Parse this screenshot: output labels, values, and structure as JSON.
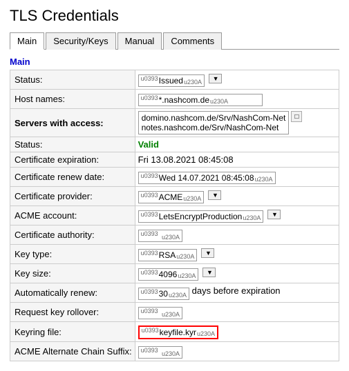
{
  "title": "TLS Credentials",
  "tabs": [
    {
      "label": "Main",
      "active": true
    },
    {
      "label": "Security/Keys",
      "active": false
    },
    {
      "label": "Manual",
      "active": false
    },
    {
      "label": "Comments",
      "active": false
    }
  ],
  "section": "Main",
  "fields": [
    {
      "label": "Status:",
      "bold": false,
      "type": "field-dropdown",
      "value": "Issued",
      "hasDropdown": true
    },
    {
      "label": "Host names:",
      "bold": false,
      "type": "field",
      "value": "*.nashcom.de"
    },
    {
      "label": "Servers with access:",
      "bold": true,
      "type": "servers",
      "values": [
        "domino.nashcom.de/Srv/NashCom-Net",
        "notes.nashcom.de/Srv/NashCom-Net"
      ]
    },
    {
      "label": "Status:",
      "bold": false,
      "type": "status",
      "value": "Valid"
    },
    {
      "label": "Certificate expiration:",
      "bold": false,
      "type": "text",
      "value": "Fri 13.08.2021 08:45:08"
    },
    {
      "label": "Certificate renew date:",
      "bold": false,
      "type": "field",
      "value": "Wed 14.07.2021 08:45:08"
    },
    {
      "label": "Certificate provider:",
      "bold": false,
      "type": "field-dropdown",
      "value": "ACME",
      "hasDropdown": true
    },
    {
      "label": "ACME account:",
      "bold": false,
      "type": "field-dropdown",
      "value": "LetsEncryptProduction",
      "hasDropdown": true
    },
    {
      "label": "Certificate authority:",
      "bold": false,
      "type": "field",
      "value": ""
    },
    {
      "label": "Key type:",
      "bold": false,
      "type": "field-dropdown",
      "value": "RSA",
      "hasDropdown": true
    },
    {
      "label": "Key size:",
      "bold": false,
      "type": "field-dropdown",
      "value": "4096",
      "hasDropdown": true
    },
    {
      "label": "Automatically renew:",
      "bold": false,
      "type": "text-mixed",
      "value": "30",
      "suffix": " days before expiration"
    },
    {
      "label": "Request key rollover:",
      "bold": false,
      "type": "field",
      "value": ""
    },
    {
      "label": "Keyring file:",
      "bold": false,
      "type": "field-highlight",
      "value": "keyfile.kyr"
    },
    {
      "label": "ACME Alternate Chain Suffix:",
      "bold": false,
      "type": "field",
      "value": ""
    }
  ]
}
